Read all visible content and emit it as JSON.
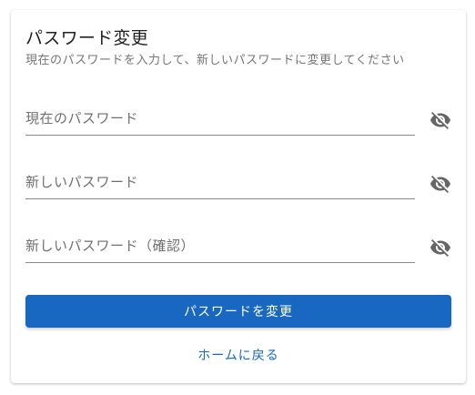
{
  "card": {
    "title": "パスワード変更",
    "subtitle": "現在のパスワードを入力して、新しいパスワードに変更してください"
  },
  "fields": [
    {
      "placeholder": "現在のパスワード",
      "value": "",
      "toggle_icon": "eye-off-icon"
    },
    {
      "placeholder": "新しいパスワード",
      "value": "",
      "toggle_icon": "eye-off-icon"
    },
    {
      "placeholder": "新しいパスワード（確認）",
      "value": "",
      "toggle_icon": "eye-off-icon"
    }
  ],
  "actions": {
    "submit_label": "パスワードを変更",
    "home_link_label": "ホームに戻る"
  },
  "colors": {
    "primary": "#1867c0",
    "title_text": "#212121",
    "subtitle_text": "#757575",
    "icon": "#666666"
  }
}
